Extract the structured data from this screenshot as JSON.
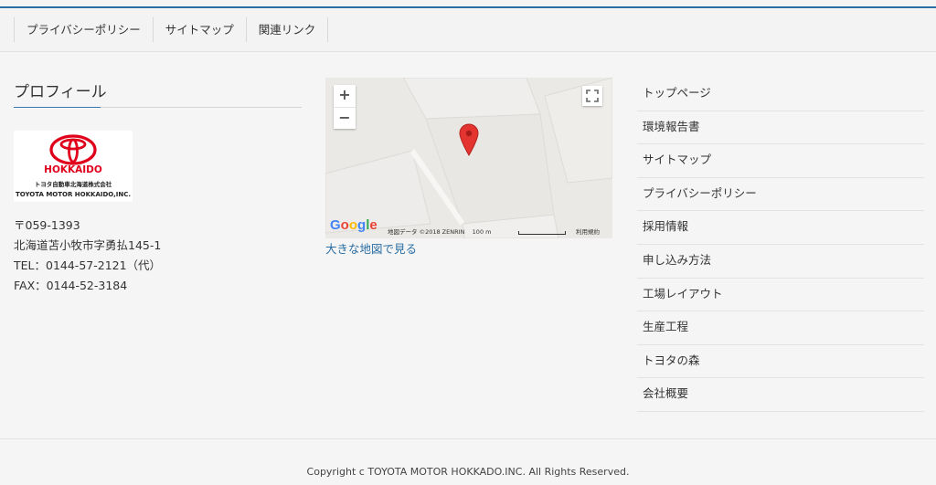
{
  "top_nav": [
    "プライバシーポリシー",
    "サイトマップ",
    "関連リンク"
  ],
  "profile": {
    "title": "プロフィール",
    "logo": {
      "brand": "HOKKAIDO",
      "jp_name": "トヨタ自動車北海道株式会社",
      "en_name": "TOYOTA MOTOR HOKKAIDO,INC."
    },
    "postal": "〒059-1393",
    "address": "北海道苫小牧市字勇払145-1",
    "tel": "TEL：0144-57-2121（代）",
    "fax": "FAX：0144-52-3184"
  },
  "map": {
    "zoom_in": "+",
    "zoom_out": "−",
    "google": [
      "G",
      "o",
      "o",
      "g",
      "l",
      "e"
    ],
    "google_colors": [
      "#4285F4",
      "#EA4335",
      "#FBBC05",
      "#4285F4",
      "#34A853",
      "#EA4335"
    ],
    "attribution": "地図データ ©2018 ZENRIN",
    "scale": "100 m",
    "terms": "利用規約",
    "larger_map_link": "大きな地図で見る",
    "pin_color": "#e3342f"
  },
  "side_nav": [
    "トップページ",
    "環境報告書",
    "サイトマップ",
    "プライバシーポリシー",
    "採用情報",
    "申し込み方法",
    "工場レイアウト",
    "生産工程",
    "トヨタの森",
    "会社概要"
  ],
  "footer": {
    "copyright": "Copyright c TOYOTA MOTOR HOKKADO.INC. All Rights Reserved."
  },
  "colors": {
    "accent": "#2a6ea3",
    "toyota_red": "#e0001b"
  }
}
